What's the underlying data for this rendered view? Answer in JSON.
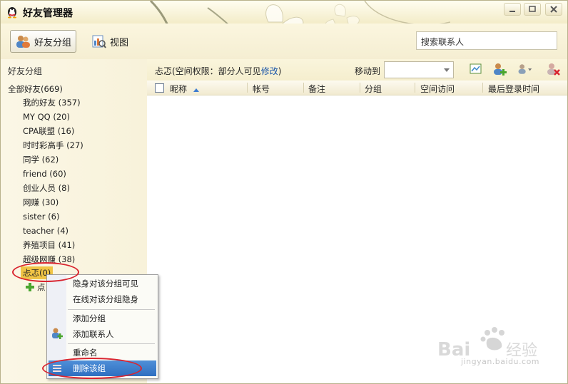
{
  "window": {
    "title": "好友管理器"
  },
  "toolbar": {
    "buttons": [
      {
        "label": "好友分组",
        "active": true
      },
      {
        "label": "视图",
        "active": false
      }
    ],
    "search_placeholder": "搜索联系人"
  },
  "sidebar": {
    "header": "好友分组",
    "root": "全部好友(669)",
    "groups": [
      "我的好友 (357)",
      "MY QQ (20)",
      "CPA联盟 (16)",
      "时时彩高手 (27)",
      "同学 (62)",
      "friend (60)",
      "创业人员 (8)",
      "网赚 (30)",
      "sister (6)",
      "teacher (4)",
      "养殖项目 (41)",
      "超级网赚 (38)",
      "忐忑(0)"
    ],
    "add_group": "点"
  },
  "main": {
    "group_info_prefix": "忐忑(空间权限：部分人可见",
    "group_info_link": "修改",
    "group_info_suffix": ")",
    "move_to": "移动到",
    "move_to_value": "",
    "columns": [
      "昵称",
      "帐号",
      "备注",
      "分组",
      "空间访问",
      "最后登录时间"
    ]
  },
  "context_menu": {
    "items": [
      "隐身对该分组可见",
      "在线对该分组隐身",
      "添加分组",
      "添加联系人",
      "重命名",
      "删除该组"
    ],
    "highlighted": "删除该组"
  },
  "watermark": {
    "text": "jingyan.baidu.com"
  },
  "colors": {
    "selected_group": "#f0c445",
    "menu_highlight": "#2f6fc0",
    "annotation": "#d9242f",
    "link": "#1a55a8"
  }
}
